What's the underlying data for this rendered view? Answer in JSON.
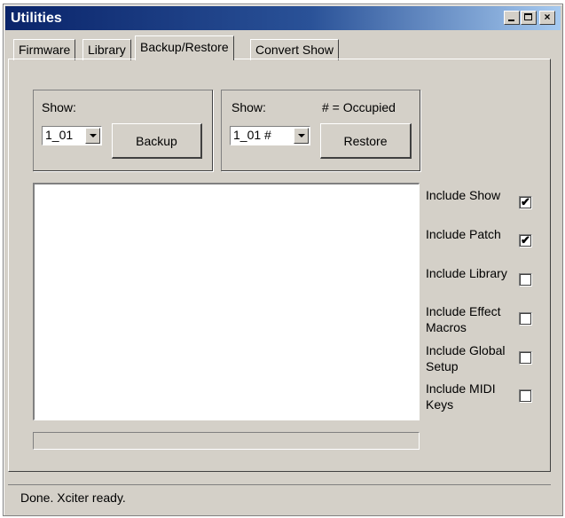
{
  "window": {
    "title": "Utilities"
  },
  "title_buttons": {
    "minimize": "minimize",
    "maximize": "maximize",
    "close": "×"
  },
  "tabs": [
    {
      "label": "Firmware",
      "active": false
    },
    {
      "label": "Library",
      "active": false
    },
    {
      "label": "Backup/Restore",
      "active": true
    },
    {
      "label": "Convert Show",
      "active": false
    }
  ],
  "backup": {
    "show_label": "Show:",
    "show_value": "1_01",
    "button_label": "Backup"
  },
  "restore": {
    "show_label": "Show:",
    "occupied_note": "# = Occupied",
    "show_value": "1_01 #",
    "button_label": "Restore"
  },
  "options": [
    {
      "label": "Include Show",
      "checked": true
    },
    {
      "label": "Include Patch",
      "checked": true
    },
    {
      "label": "Include Library",
      "checked": false
    },
    {
      "label": "Include Effect Macros",
      "checked": false
    },
    {
      "label": "Include Global Setup",
      "checked": false
    },
    {
      "label": "Include MIDI Keys",
      "checked": false
    }
  ],
  "progress": {
    "value": 0
  },
  "status": {
    "text": "Done. Xciter ready."
  },
  "icons": {
    "checkmark": "✔",
    "dropdown_arrow": "chevron-down-icon"
  },
  "colors": {
    "titlebar": "#0a246a",
    "face": "#d4d0c8"
  }
}
